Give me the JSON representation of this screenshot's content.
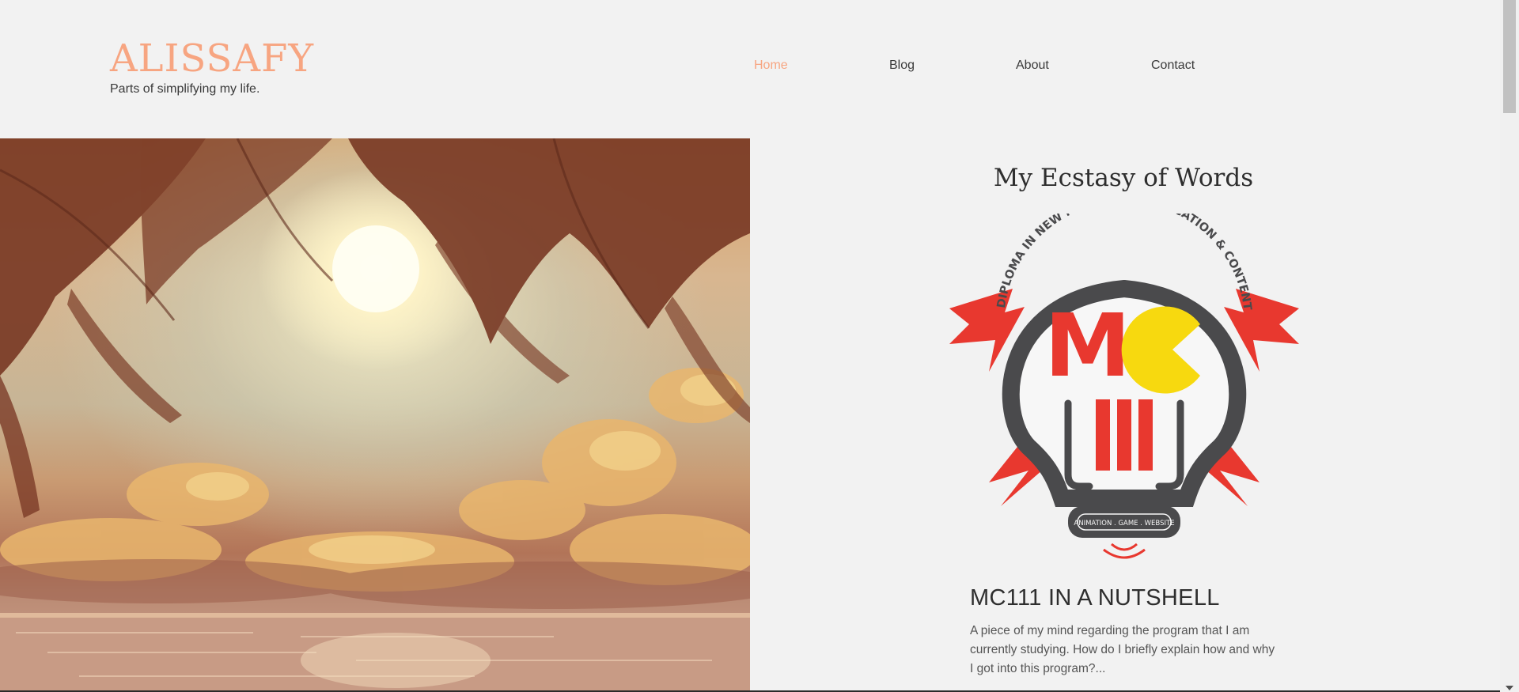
{
  "site": {
    "title": "ALISSAFY",
    "tagline": "Parts of simplifying my life."
  },
  "nav": {
    "items": [
      {
        "label": "Home",
        "active": true
      },
      {
        "label": "Blog",
        "active": false
      },
      {
        "label": "About",
        "active": false
      },
      {
        "label": "Contact",
        "active": false
      }
    ]
  },
  "hero": {
    "description": "tropical-sunset-image"
  },
  "blog": {
    "heading": "My Ecstasy of Words",
    "post": {
      "logo_letters": "MC",
      "logo_ring_text": "DIPLOMA IN NEW MEDIA COMMUNICATION & CONTENTPRENEURSHIP",
      "logo_base_text": "ANIMATION . GAME . WEBSITE",
      "title": "MC111 IN A NUTSHELL",
      "excerpt": "A piece of my mind regarding the program that I am currently studying. How do I briefly explain how and why I got into this program?..."
    }
  },
  "colors": {
    "accent": "#f7a581",
    "background": "#f2f2f2",
    "text": "#3a3a3a",
    "logo_red": "#e8382f",
    "logo_yellow": "#f7d90f",
    "logo_gray": "#4a4a4c"
  }
}
